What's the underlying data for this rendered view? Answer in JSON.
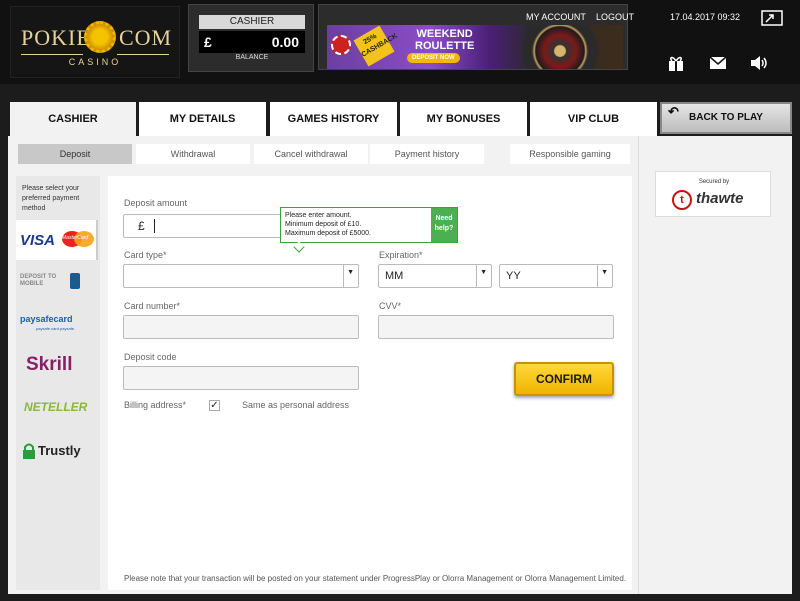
{
  "header": {
    "logo": {
      "left": "POKIES",
      "right": "COM",
      "sub": "CASINO"
    },
    "cashier": {
      "title": "CASHIER",
      "currency": "£",
      "balance": "0.00",
      "balance_label": "BALANCE"
    },
    "banner": {
      "tag": "25% CASHBACK",
      "title_line1": "WEEKEND",
      "title_line2": "ROULETTE",
      "button": "DEPOSIT NOW"
    },
    "links": {
      "account": "MY ACCOUNT",
      "logout": "LOGOUT"
    },
    "datetime": "17.04.2017 09:32",
    "icons": [
      "fullscreen-icon",
      "gift-icon",
      "mail-icon",
      "sound-icon"
    ]
  },
  "tabs": [
    {
      "label": "CASHIER",
      "active": true
    },
    {
      "label": "MY DETAILS"
    },
    {
      "label": "GAMES HISTORY"
    },
    {
      "label": "MY BONUSES"
    },
    {
      "label": "VIP CLUB"
    }
  ],
  "back_button": "BACK TO PLAY",
  "subtabs": [
    "Deposit",
    "Withdrawal",
    "Cancel withdrawal",
    "Payment history",
    "Responsible gaming"
  ],
  "payment": {
    "note": "Please select your preferred payment method",
    "methods": [
      "VISA",
      "MasterCard",
      "DEPOSIT TO MOBILE",
      "paysafecard",
      "paysafe.card.paysafe.",
      "Skrill",
      "NETELLER",
      "Trustly"
    ]
  },
  "form": {
    "tooltip": {
      "line1": "Please enter amount.",
      "line2": "Minimum deposit of £10.",
      "line3": "Maximum deposit of £5000.",
      "help": "Need help?"
    },
    "deposit_amount_label": "Deposit amount",
    "currency_symbol": "£",
    "card_type_label": "Card type*",
    "expiration_label": "Expiration*",
    "month_value": "MM",
    "year_value": "YY",
    "card_number_label": "Card number*",
    "cvv_label": "CVV*",
    "deposit_code_label": "Deposit code",
    "billing_label": "Billing address*",
    "same_as_label": "Same as personal address",
    "confirm": "CONFIRM",
    "note": "Please note that your transaction will be posted on your statement under ProgressPlay or Olorra Management or Olorra Management Limited."
  },
  "security": {
    "secured_by": "Secured by",
    "brand": "thawte"
  }
}
